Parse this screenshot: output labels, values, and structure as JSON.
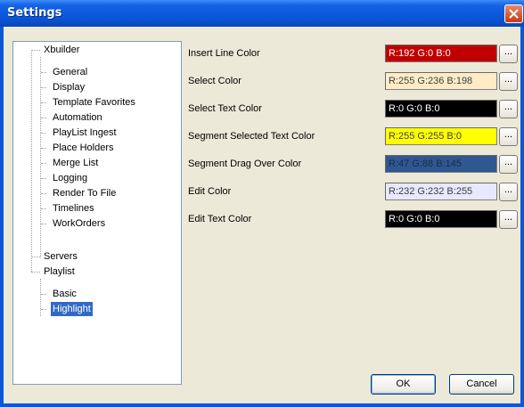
{
  "window": {
    "title": "Settings",
    "close_glyph": "✕"
  },
  "tree": {
    "root": "Xbuilder",
    "xbuilder_children": [
      "General",
      "Display",
      "Template Favorites",
      "Automation",
      "PlayList Ingest",
      "Place Holders",
      "Merge List",
      "Logging",
      "Render To File",
      "Timelines",
      "WorkOrders"
    ],
    "servers": "Servers",
    "playlist": "Playlist",
    "playlist_children": [
      "Basic",
      "Highlight"
    ],
    "selected": "Highlight"
  },
  "properties": [
    {
      "label": "Insert Line Color",
      "value": "R:192 G:0 B:0",
      "bg": "#c00000",
      "fg": "#ffffff",
      "button": "..."
    },
    {
      "label": "Select Color",
      "value": "R:255 G:236 B:198",
      "bg": "#ffecc6",
      "fg": "#404040",
      "button": "..."
    },
    {
      "label": "Select Text Color",
      "value": "R:0 G:0 B:0",
      "bg": "#000000",
      "fg": "#ffffff",
      "button": "..."
    },
    {
      "label": "Segment Selected Text Color",
      "value": "R:255 G:255 B:0",
      "bg": "#ffff00",
      "fg": "#404040",
      "button": "..."
    },
    {
      "label": "Segment Drag Over Color",
      "value": "R:47 G:88 B:145",
      "bg": "#2f5891",
      "fg": "#1a2a44",
      "button": "..."
    },
    {
      "label": "Edit Color",
      "value": "R:232 G:232 B:255",
      "bg": "#e8e8ff",
      "fg": "#404040",
      "button": "..."
    },
    {
      "label": "Edit Text Color",
      "value": "R:0 G:0 B:0",
      "bg": "#000000",
      "fg": "#ffffff",
      "button": "..."
    }
  ],
  "buttons": {
    "ok": "OK",
    "cancel": "Cancel"
  },
  "colors": {
    "title_bar": "#0a55d6",
    "dialog_bg": "#ece9d8",
    "selection": "#316ac5",
    "close_button": "#c83a14"
  }
}
